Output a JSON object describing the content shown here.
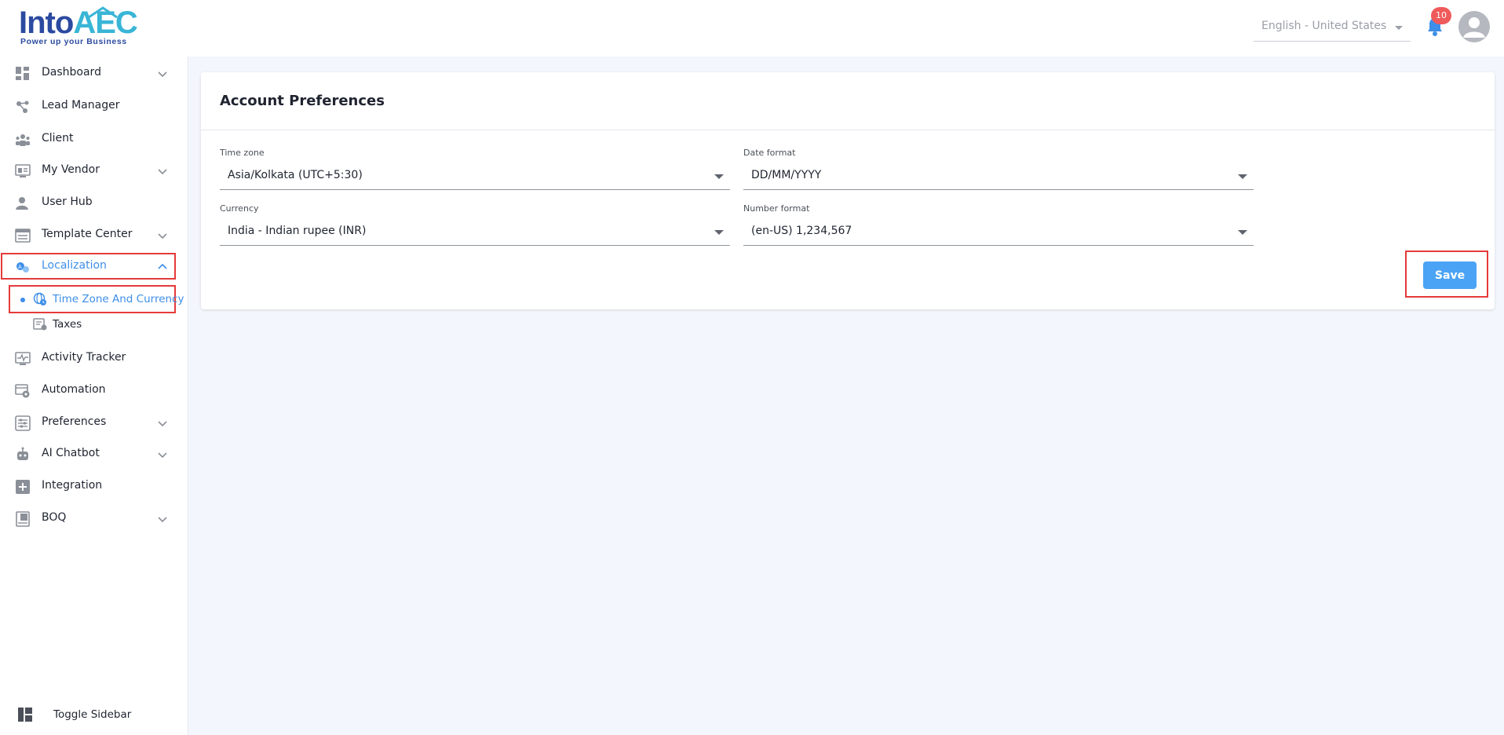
{
  "header": {
    "logo": {
      "word_into": "Into",
      "word_aec": "AEC",
      "tagline": "Power up your Business"
    },
    "language": {
      "value": "English - United States"
    },
    "notifications": {
      "count": "10"
    },
    "avatar_icon": "user-avatar-icon"
  },
  "sidebar": {
    "items": [
      {
        "label": "Dashboard",
        "icon": "dashboard-icon",
        "chevron": "down"
      },
      {
        "label": "Lead Manager",
        "icon": "lead-manager-icon"
      },
      {
        "label": "Client",
        "icon": "client-icon"
      },
      {
        "label": "My Vendor",
        "icon": "vendor-icon",
        "chevron": "down"
      },
      {
        "label": "User Hub",
        "icon": "user-icon"
      },
      {
        "label": "Template Center",
        "icon": "template-icon",
        "chevron": "down"
      },
      {
        "label": "Localization",
        "icon": "localization-icon",
        "chevron": "up",
        "active": true
      },
      {
        "label": "Activity Tracker",
        "icon": "activity-icon"
      },
      {
        "label": "Automation",
        "icon": "automation-icon"
      },
      {
        "label": "Preferences",
        "icon": "preferences-icon",
        "chevron": "down"
      },
      {
        "label": "AI Chatbot",
        "icon": "chatbot-icon",
        "chevron": "down"
      },
      {
        "label": "Integration",
        "icon": "integration-icon"
      },
      {
        "label": "BOQ",
        "icon": "boq-icon",
        "chevron": "down"
      }
    ],
    "sub_items": [
      {
        "label": "Time Zone And Currency",
        "icon": "globe-clock-icon",
        "active": true
      },
      {
        "label": "Taxes",
        "icon": "taxes-icon"
      }
    ],
    "toggle_label": "Toggle Sidebar"
  },
  "main": {
    "title": "Account Preferences",
    "fields": {
      "timezone": {
        "label": "Time zone",
        "value": "Asia/Kolkata (UTC+5:30)"
      },
      "date_format": {
        "label": "Date format",
        "value": "DD/MM/YYYY"
      },
      "currency": {
        "label": "Currency",
        "value": "India - Indian rupee (INR)"
      },
      "number_format": {
        "label": "Number format",
        "value": "(en-US) 1,234,567"
      }
    },
    "save_label": "Save"
  },
  "colors": {
    "accent": "#3d8ee8",
    "save_button": "#4aa3f5",
    "highlight": "#e53a3a",
    "badge": "#ef5a5a",
    "background": "#f3f6fc"
  }
}
